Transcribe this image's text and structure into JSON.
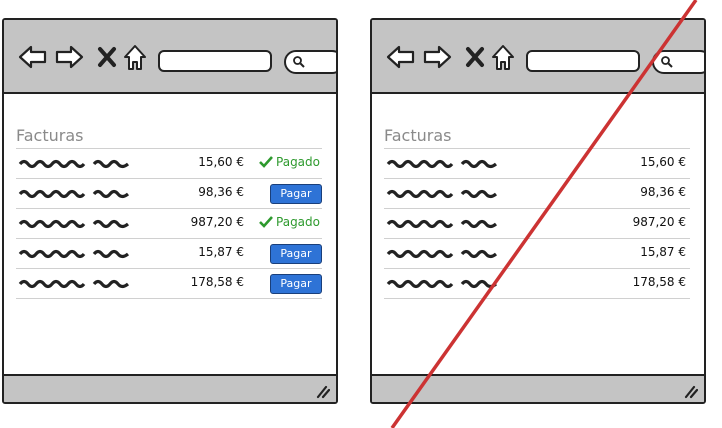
{
  "left": {
    "title": "Facturas",
    "rows": [
      {
        "amount": "15,60 €",
        "status": "Pagado"
      },
      {
        "amount": "98,36 €",
        "status": "Pagar"
      },
      {
        "amount": "987,20 €",
        "status": "Pagado"
      },
      {
        "amount": "15,87 €",
        "status": "Pagar"
      },
      {
        "amount": "178,58 €",
        "status": "Pagar"
      }
    ]
  },
  "right": {
    "title": "Facturas",
    "rows": [
      {
        "amount": "15,60 €"
      },
      {
        "amount": "98,36 €"
      },
      {
        "amount": "987,20 €"
      },
      {
        "amount": "15,87 €"
      },
      {
        "amount": "178,58 €"
      }
    ]
  },
  "colors": {
    "paid_green": "#2e9a2e",
    "pay_blue": "#2e73d6",
    "strike_red": "#cc3333",
    "chrome_gray": "#c4c4c4"
  },
  "icons": [
    "back-arrow-icon",
    "forward-arrow-icon",
    "close-x-icon",
    "home-icon",
    "search-icon",
    "resize-grip-icon",
    "check-icon"
  ]
}
